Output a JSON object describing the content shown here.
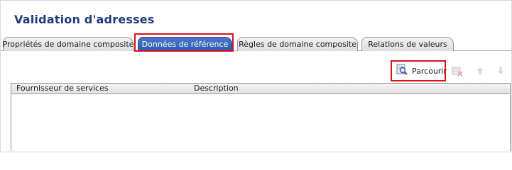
{
  "window": {
    "title": "Validation d'adresses"
  },
  "tabs": [
    {
      "label": "Propriétés de domaine composite",
      "active": false
    },
    {
      "label": "Données de référence",
      "active": true
    },
    {
      "label": "Règles de domaine composite",
      "active": false
    },
    {
      "label": "Relations de valeurs",
      "active": false
    }
  ],
  "toolbar": {
    "browse_label": "Parcourir",
    "icons": [
      "search-icon",
      "delete-icon",
      "move-up-icon",
      "move-down-icon"
    ]
  },
  "grid": {
    "columns": [
      "Fournisseur de services",
      "Description"
    ],
    "rows": []
  },
  "colors": {
    "title": "#1f3b7a",
    "active_tab": "#2a5bb4",
    "highlight": "#e0101b"
  }
}
